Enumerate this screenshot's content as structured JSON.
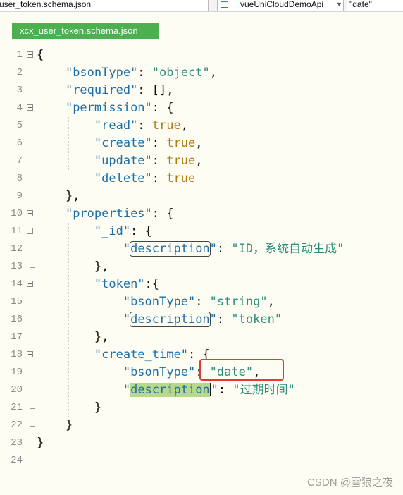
{
  "topbar": {
    "file_name": "user_token.schema.json",
    "project_name": "vueUniCloudDemoApi",
    "search_value": "\"date\""
  },
  "tab": {
    "title": "xcx_user_token.schema.json"
  },
  "code": {
    "line_numbers": [
      "1",
      "2",
      "3",
      "4",
      "5",
      "6",
      "7",
      "8",
      "9",
      "10",
      "11",
      "12",
      "13",
      "14",
      "15",
      "16",
      "17",
      "18",
      "19",
      "20",
      "21",
      "22",
      "23",
      "24"
    ],
    "l1": "{",
    "l2_key": "\"bsonType\"",
    "l2_val": "\"object\"",
    "l3_key": "\"required\"",
    "l3_val": "[]",
    "l4_key": "\"permission\"",
    "l5_key": "\"read\"",
    "l5_val": "true",
    "l6_key": "\"create\"",
    "l6_val": "true",
    "l7_key": "\"update\"",
    "l7_val": "true",
    "l8_key": "\"delete\"",
    "l8_val": "true",
    "l10_key": "\"properties\"",
    "l11_key": "\"_id\"",
    "l12_key": "description",
    "l12_val": "\"ID，系统自动生成\"",
    "l14_key": "\"token\"",
    "l15_key": "\"bsonType\"",
    "l15_val": "\"string\"",
    "l16_key": "description",
    "l16_val": "\"token\"",
    "l18_key": "\"create_time\"",
    "l19_key": "\"bsonType\"",
    "l19_val": "\"date\"",
    "l20_key": "description",
    "l20_val": "\"过期时间\""
  },
  "watermark": "CSDN @雪狼之夜"
}
